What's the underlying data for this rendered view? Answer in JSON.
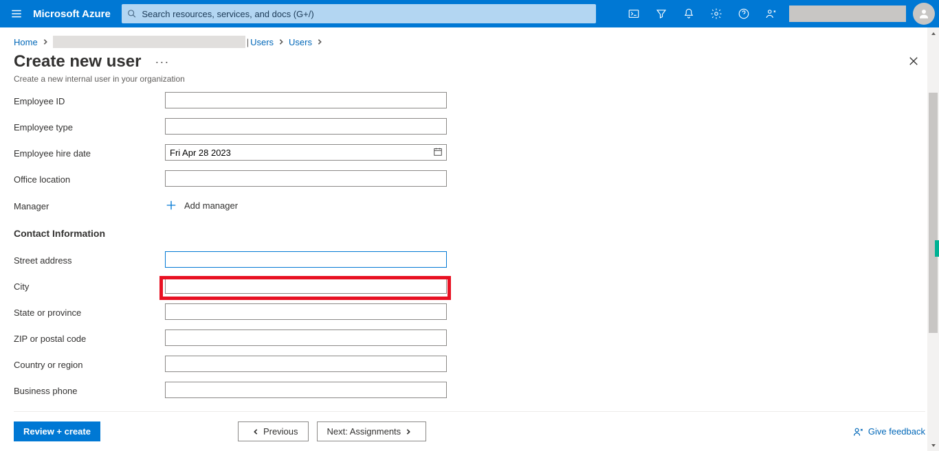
{
  "header": {
    "brand": "Microsoft Azure",
    "search_placeholder": "Search resources, services, and docs (G+/)"
  },
  "breadcrumb": {
    "home": "Home",
    "users1": "Users",
    "users2": "Users"
  },
  "page": {
    "title": "Create new user",
    "subtitle": "Create a new internal user in your organization"
  },
  "form": {
    "labels": {
      "employee_id": "Employee ID",
      "employee_type": "Employee type",
      "employee_hire_date": "Employee hire date",
      "office_location": "Office location",
      "manager": "Manager",
      "street_address": "Street address",
      "city": "City",
      "state": "State or province",
      "zip": "ZIP or postal code",
      "country": "Country or region",
      "business_phone": "Business phone"
    },
    "values": {
      "employee_id": "",
      "employee_type": "",
      "employee_hire_date": "Fri Apr 28 2023",
      "office_location": "",
      "street_address": "",
      "city": "",
      "state": "",
      "zip": "",
      "country": "",
      "business_phone": ""
    },
    "add_manager": "Add manager",
    "section_contact": "Contact Information"
  },
  "footer": {
    "review_create": "Review + create",
    "previous": "Previous",
    "next": "Next: Assignments",
    "feedback": "Give feedback"
  }
}
